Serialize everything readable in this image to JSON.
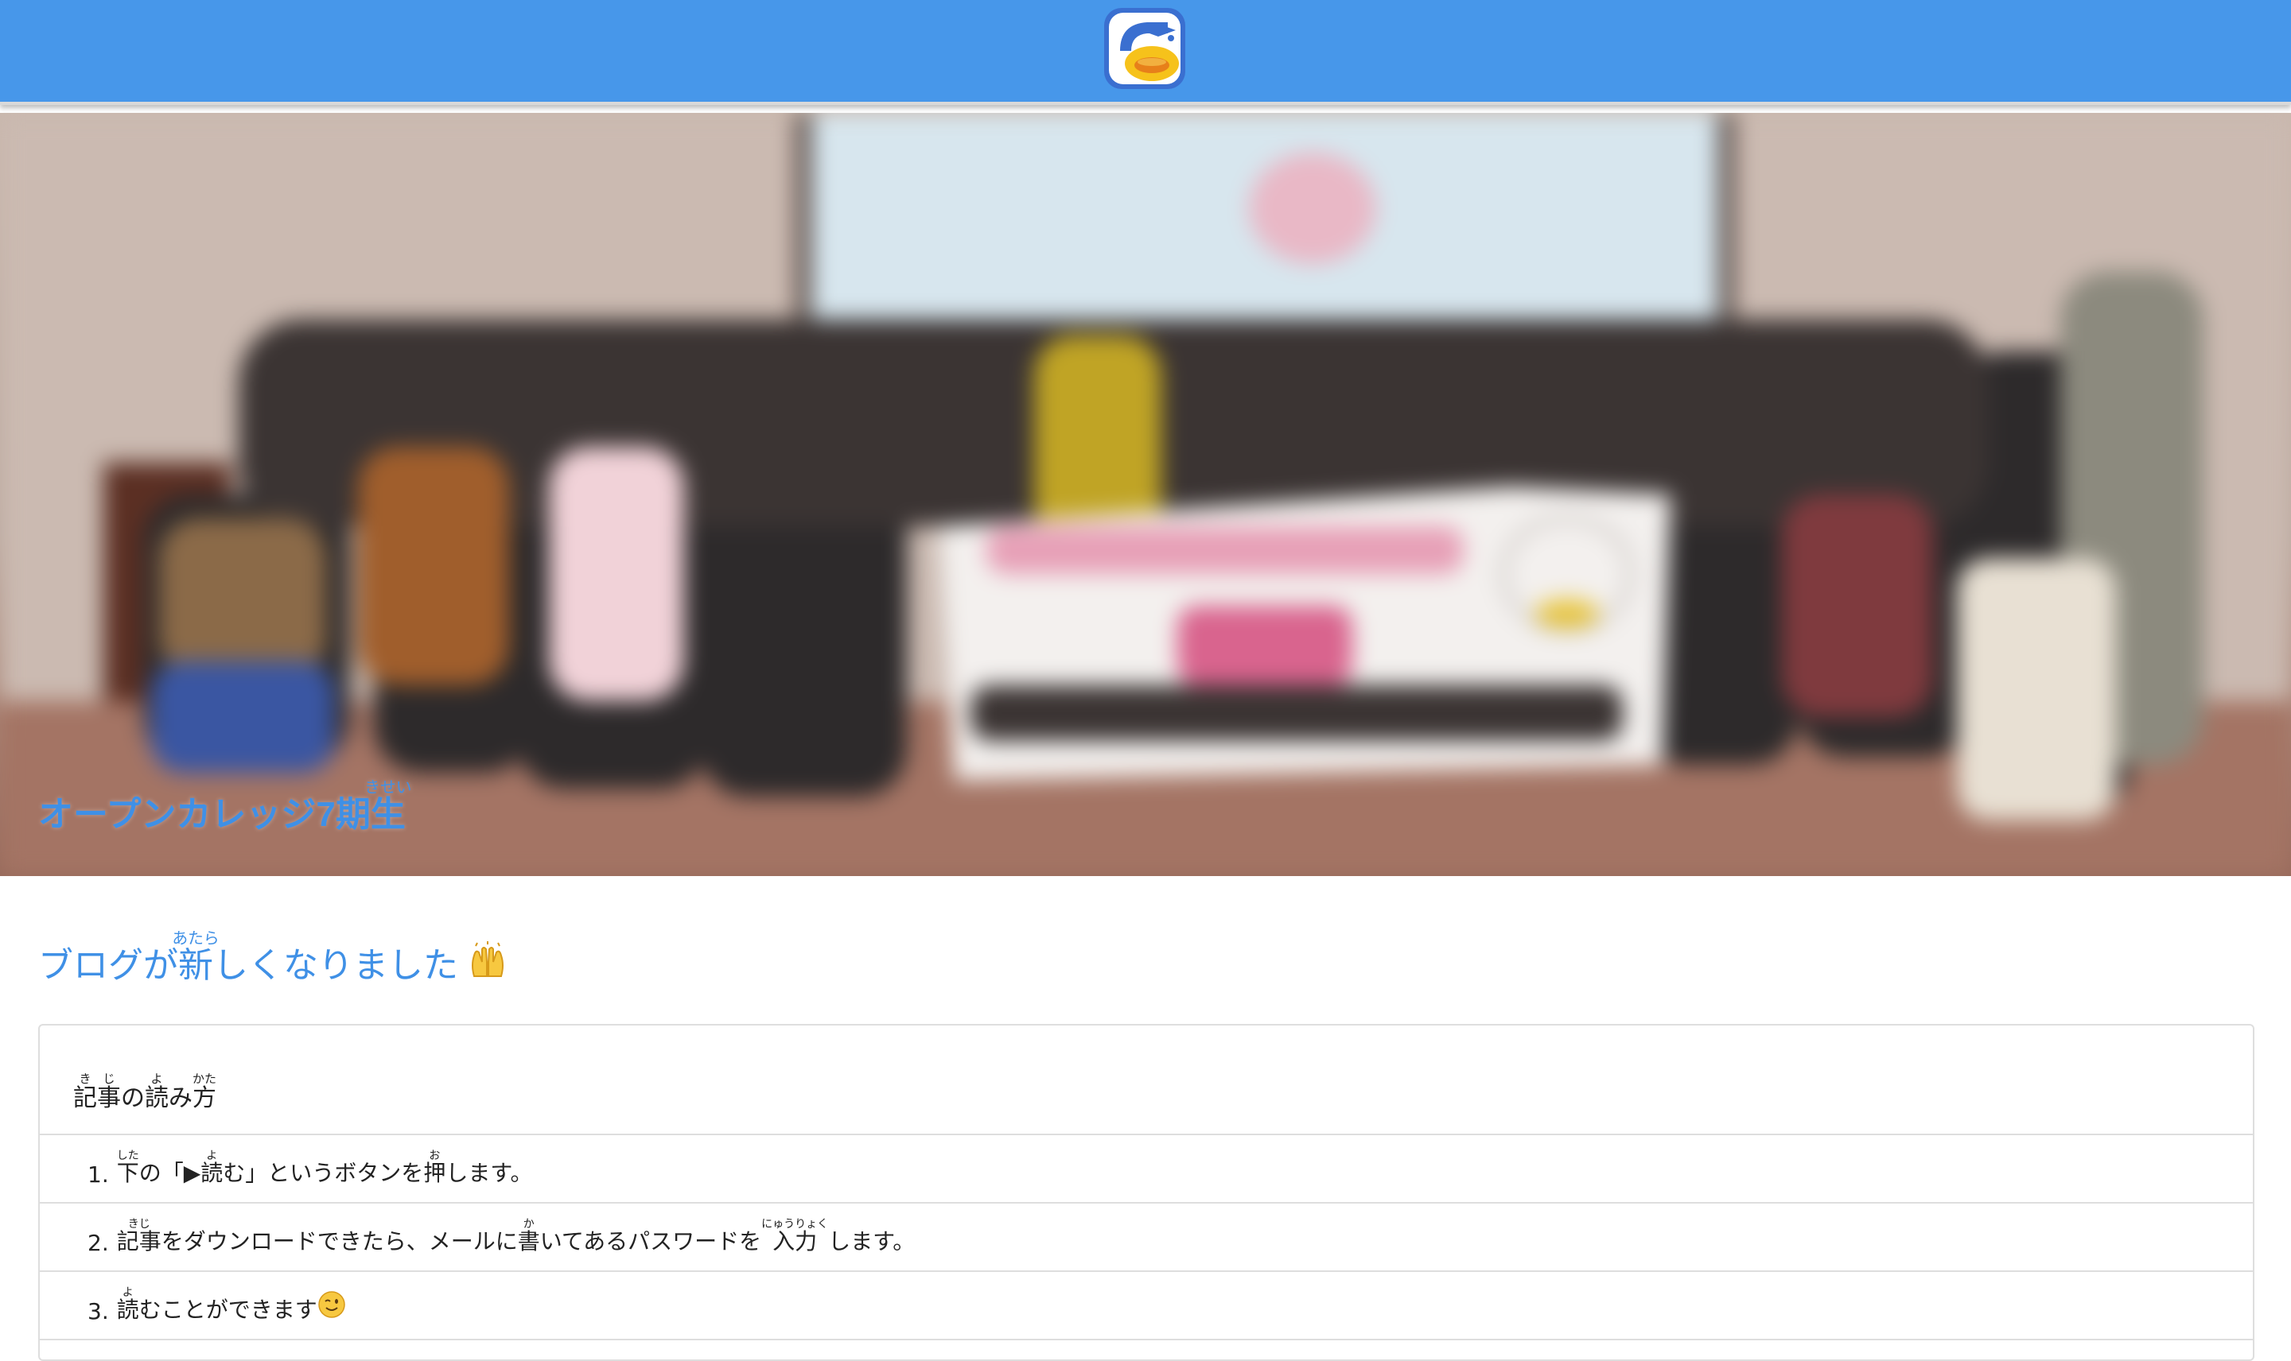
{
  "header": {
    "logo_icon": "duck-graduation-cap-logo-icon",
    "background": "#4797ea"
  },
  "hero": {
    "photo_description_icon": "group-photo",
    "caption_text": "オープンカレッジ7期",
    "caption_kanji": "生",
    "caption_ruby": "きせい",
    "caption_color": "#3f90e6"
  },
  "blog": {
    "title_pre": "ブログが",
    "title_kanji": "新",
    "title_ruby": "あたら",
    "title_post": "しくなりました",
    "title_emoji": "raising-hands-icon"
  },
  "instructions": {
    "heading": {
      "k1": "記",
      "r1": "き",
      "k2": "事",
      "r2": "じ",
      "mid": "の",
      "k3": "読",
      "r3": "よ",
      "mid2": "み",
      "k4": "方",
      "r4": "かた"
    },
    "steps": [
      {
        "num": "1.",
        "k1": "下",
        "r1": "した",
        "t1": "の「▶ ",
        "k2": "読",
        "r2": "よ",
        "t2": "む」というボタンを",
        "k3": "押",
        "r3": "お",
        "t3": "します。"
      },
      {
        "num": "2.",
        "k1": "記事",
        "r1": "きじ",
        "t1": "をダウンロードできたら、メールに",
        "k2": "書",
        "r2": "か",
        "t2": "いてあるパスワードを",
        "k3": "入力",
        "r3": "にゅうりょく",
        "t3": "します。"
      },
      {
        "num": "3.",
        "k1": "読",
        "r1": "よ",
        "t1": "むことができます",
        "emoji": "winking-face-icon"
      }
    ]
  }
}
